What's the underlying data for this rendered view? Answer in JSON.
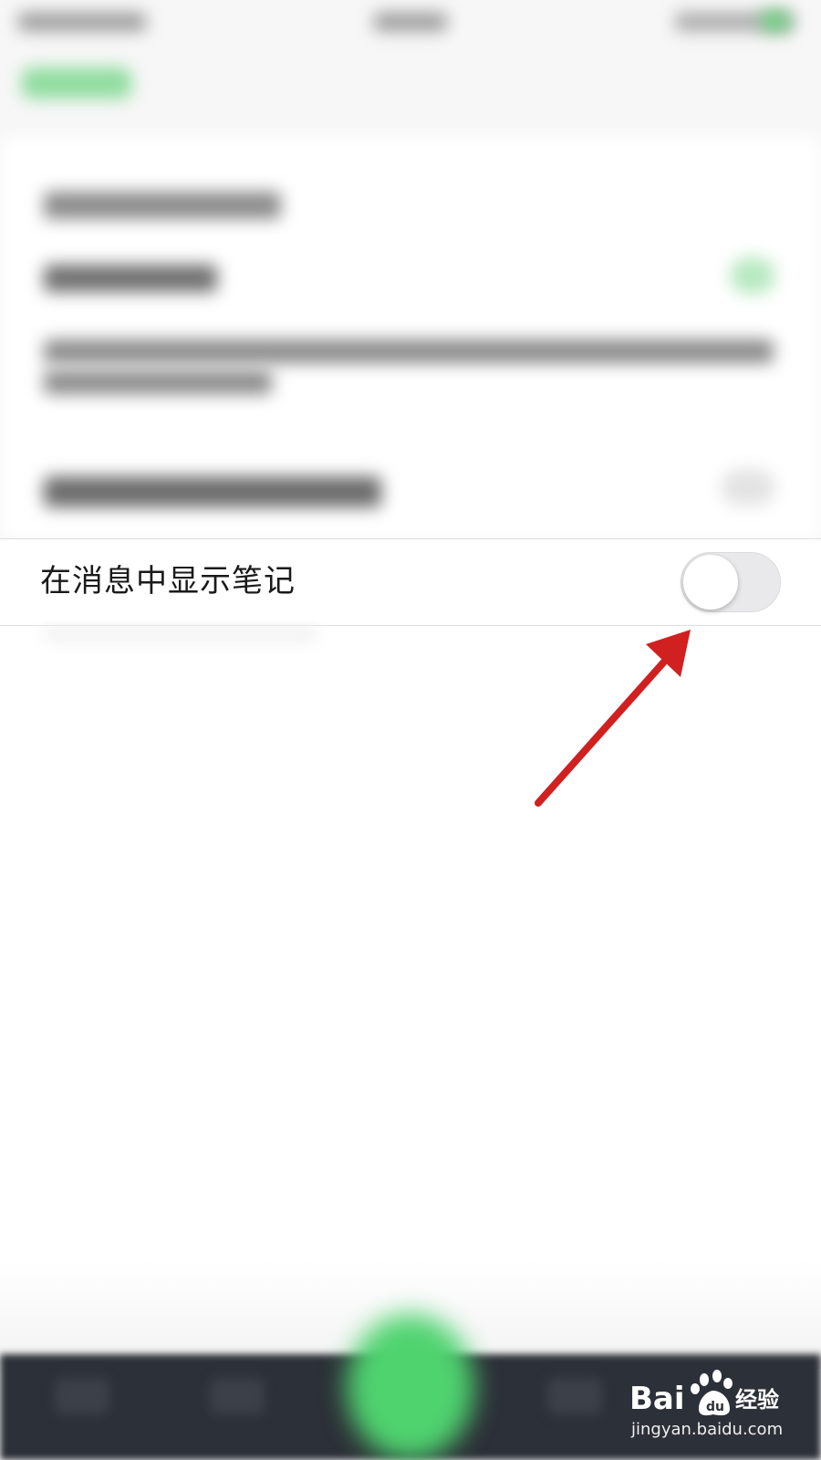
{
  "setting": {
    "label": "在消息中显示笔记",
    "toggle_on": false
  },
  "watermark": {
    "logo_text": "Bai du 经验",
    "url": "jingyan.baidu.com"
  },
  "colors": {
    "arrow": "#d02020",
    "fab_green": "#4fd36f",
    "tabbar_bg": "#2c3038",
    "toggle_off_bg": "#e9e9eb"
  },
  "icons": {
    "annotation": "red-arrow-icon",
    "baidu_paw": "baidu-paw-icon"
  }
}
